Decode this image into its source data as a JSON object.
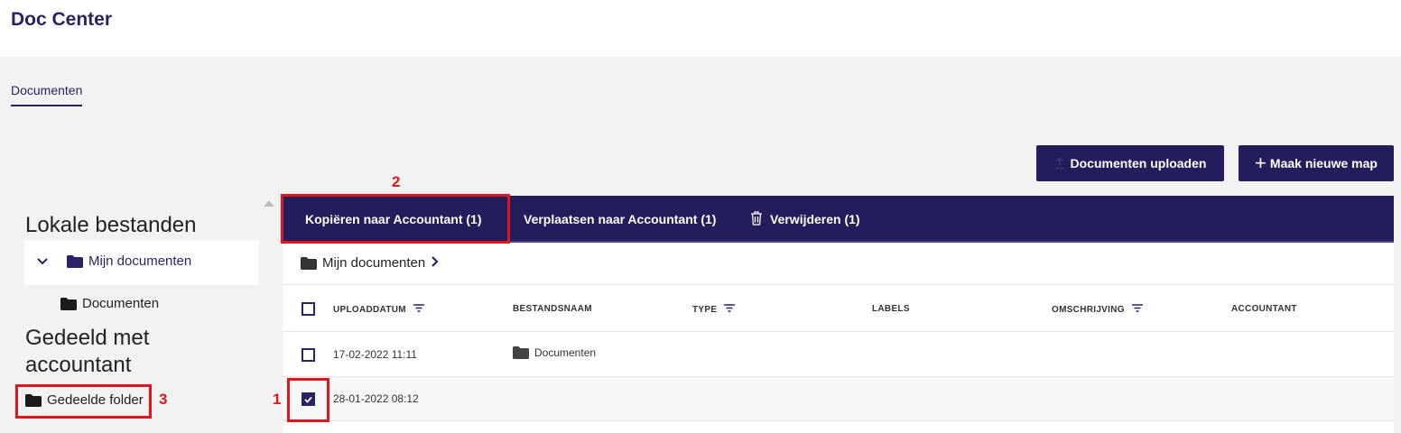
{
  "header": {
    "title": "Doc Center"
  },
  "tabs": [
    {
      "label": "Documenten",
      "active": true
    }
  ],
  "toolbar": {
    "upload_label": "Documenten uploaden",
    "new_folder_label": "Maak nieuwe map",
    "new_folder_icon": "+"
  },
  "sidebar": {
    "local_heading": "Lokale bestanden",
    "tree": [
      {
        "label": "Mijn documenten",
        "expanded": true,
        "selected": true
      },
      {
        "label": "Documenten"
      }
    ],
    "shared_heading": "Gedeeld met accountant",
    "shared_items": [
      {
        "label": "Gedeelde folder"
      }
    ]
  },
  "actions": {
    "copy_label": "Kopiëren naar Accountant (1)",
    "move_label": "Verplaatsen naar Accountant (1)",
    "delete_label": "Verwijderen (1)"
  },
  "breadcrumb": {
    "label": "Mijn documenten"
  },
  "table": {
    "columns": [
      "UPLOADDATUM",
      "BESTANDSNAAM",
      "TYPE",
      "LABELS",
      "OMSCHRIJVING",
      "ACCOUNTANT"
    ],
    "rows": [
      {
        "date": "17-02-2022 11:11",
        "name": "Documenten",
        "is_folder": true,
        "checked": false
      },
      {
        "date": "28-01-2022 08:12",
        "name": "",
        "is_folder": false,
        "checked": true
      }
    ]
  },
  "annotations": [
    "1",
    "2",
    "3"
  ],
  "colors": {
    "brand": "#231d5c",
    "accent_text": "#2b2266",
    "annotation": "#e0151d"
  }
}
